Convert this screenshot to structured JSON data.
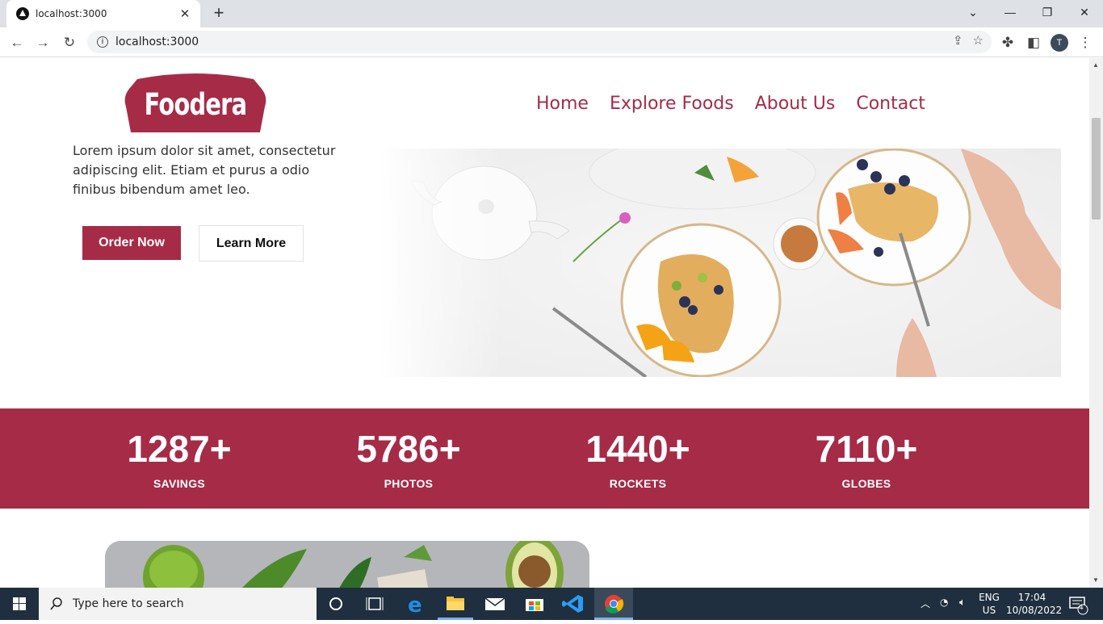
{
  "browser": {
    "tab_title": "localhost:3000",
    "url": "localhost:3000",
    "profile_initial": "T"
  },
  "site": {
    "logo_text": "Foodera",
    "nav": [
      "Home",
      "Explore Foods",
      "About Us",
      "Contact"
    ],
    "hero_text": "Lorem ipsum dolor sit amet, consectetur adipiscing elit. Etiam et purus a odio finibus bibendum amet leo.",
    "order_label": "Order Now",
    "learn_label": "Learn More",
    "stats": [
      {
        "number": "1287+",
        "label": "SAVINGS"
      },
      {
        "number": "5786+",
        "label": "PHOTOS"
      },
      {
        "number": "1440+",
        "label": "ROCKETS"
      },
      {
        "number": "7110+",
        "label": "GLOBES"
      }
    ],
    "brand_color": "#a62b47"
  },
  "taskbar": {
    "search_placeholder": "Type here to search",
    "lang_top": "ENG",
    "lang_bottom": "US",
    "time": "17:04",
    "date": "10/08/2022",
    "notification_count": "4"
  }
}
